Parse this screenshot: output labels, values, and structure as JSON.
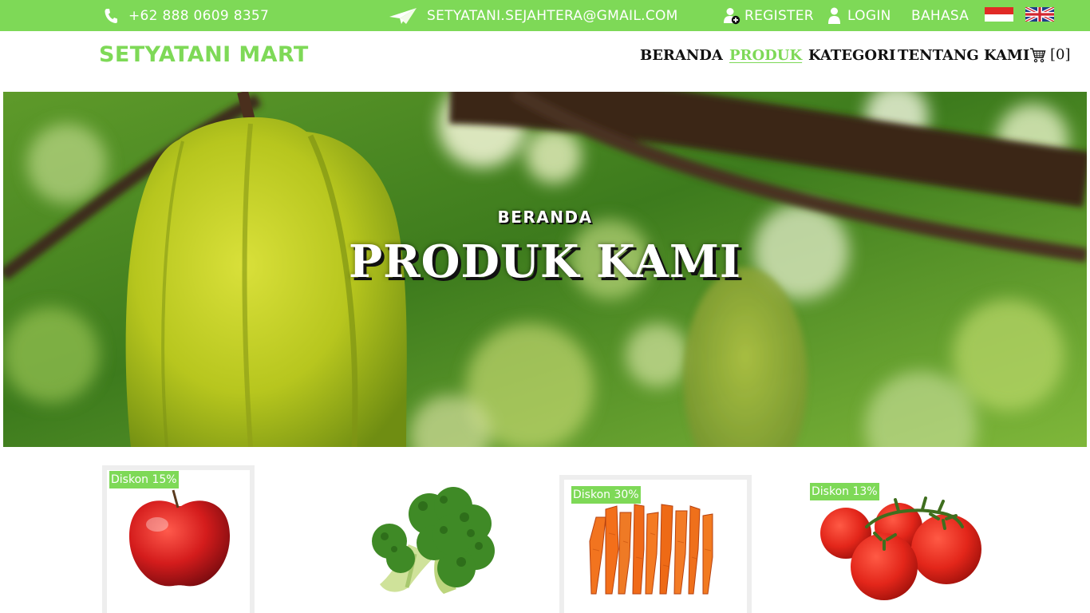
{
  "topbar": {
    "phone": "+62 888 0609 8357",
    "email": "SETYATANI.SEJAHTERA@GMAIL.COM",
    "register": "REGISTER",
    "login": "LOGIN",
    "language_label": "BAHASA",
    "flags": [
      "indonesia-flag",
      "uk-flag"
    ],
    "background_color": "#7ed957"
  },
  "navbar": {
    "brand": "SETYATANI MART",
    "items": [
      "BERANDA",
      "PRODUK",
      "KATEGORI",
      "TENTANG KAMI"
    ],
    "active_item": "PRODUK",
    "cart_label": "[0]",
    "accent_color": "#7ed957"
  },
  "hero": {
    "breadcrumb": "BERANDA",
    "title": "PRODUK KAMI"
  },
  "products": [
    {
      "badge": "Diskon 15%",
      "image": "apple"
    },
    {
      "badge": "",
      "image": "broccoli"
    },
    {
      "badge": "Diskon  30%",
      "image": "carrots"
    },
    {
      "badge": "Diskon 13%",
      "image": "tomatoes"
    }
  ]
}
